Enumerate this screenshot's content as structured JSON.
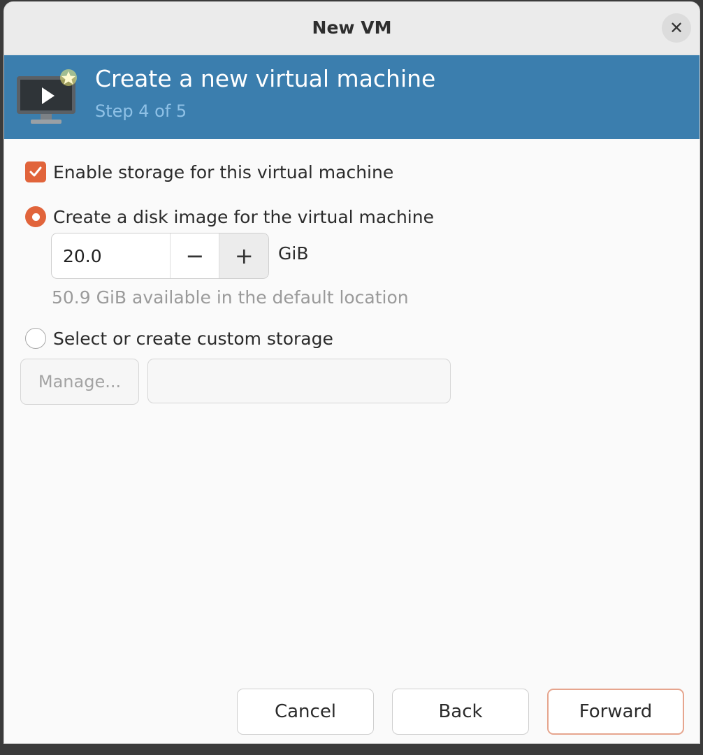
{
  "window": {
    "title": "New VM"
  },
  "banner": {
    "title": "Create a new virtual machine",
    "step": "Step 4 of 5"
  },
  "storage": {
    "enable_label": "Enable storage for this virtual machine",
    "enable_checked": true,
    "disk_image_label": "Create a disk image for the virtual machine",
    "disk_size": "20.0",
    "unit": "GiB",
    "available_hint": "50.9 GiB available in the default location",
    "custom_label": "Select or create custom storage",
    "manage_label": "Manage...",
    "custom_path_value": ""
  },
  "buttons": {
    "cancel": "Cancel",
    "back": "Back",
    "forward": "Forward"
  },
  "icons": {
    "close": "close-icon",
    "vm": "vm-monitor-icon",
    "checkbox": "checkmark-icon",
    "minus": "minus-icon",
    "plus": "plus-icon"
  },
  "colors": {
    "accent": "#e1643b",
    "banner": "#3b7eae",
    "banner_sub": "#8fc1e6"
  }
}
